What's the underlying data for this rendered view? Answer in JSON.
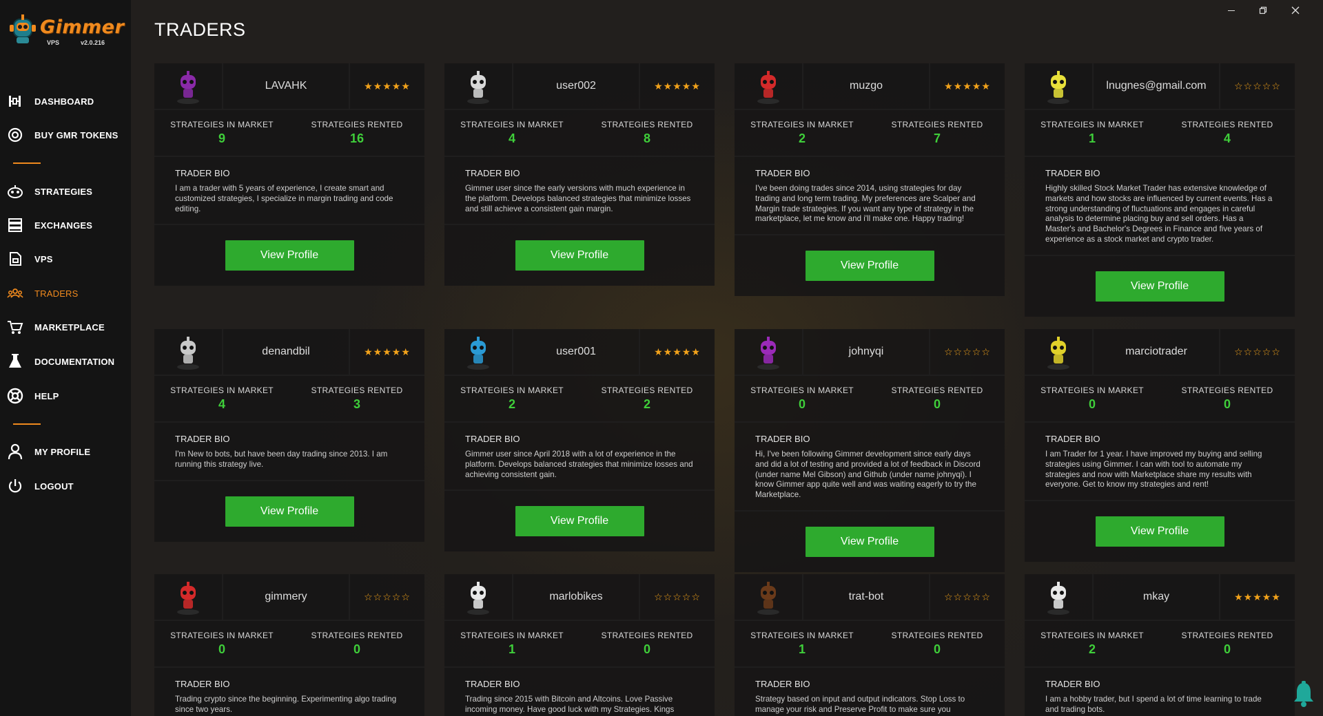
{
  "app": {
    "logo_text": "Gimmer",
    "logo_sub": "VPS",
    "version": "v2.0.216",
    "colors": {
      "accent": "#f08a1e",
      "green": "#2eaa2e",
      "value_green": "#3fcf3a",
      "star": "#f3a31b",
      "bell": "#1fa89a"
    }
  },
  "page": {
    "title": "TRADERS"
  },
  "window_controls": {
    "minimize": "minimize-icon",
    "restore": "restore-icon",
    "close": "close-icon"
  },
  "sidebar": {
    "items": [
      {
        "label": "DASHBOARD",
        "icon": "dashboard-icon"
      },
      {
        "label": "BUY GMR TOKENS",
        "icon": "coin-icon"
      },
      {
        "label": "STRATEGIES",
        "icon": "strategies-icon"
      },
      {
        "label": "EXCHANGES",
        "icon": "exchanges-icon"
      },
      {
        "label": "VPS",
        "icon": "vps-icon"
      },
      {
        "label": "TRADERS",
        "icon": "traders-icon",
        "active": true
      },
      {
        "label": "MARKETPLACE",
        "icon": "cart-icon"
      },
      {
        "label": "DOCUMENTATION",
        "icon": "documentation-icon"
      },
      {
        "label": "HELP",
        "icon": "help-icon"
      },
      {
        "label": "MY PROFILE",
        "icon": "user-icon"
      },
      {
        "label": "LOGOUT",
        "icon": "power-icon"
      }
    ]
  },
  "labels": {
    "in_market": "STRATEGIES IN MARKET",
    "rented": "STRATEGIES RENTED",
    "bio_title": "TRADER BIO",
    "view_profile": "View Profile"
  },
  "traders": [
    {
      "name": "LAVAHK",
      "rating": 5,
      "in_market": "9",
      "rented": "16",
      "avatar_color": "#8a2aa8",
      "bio": "I am a trader with 5 years of experience, I create smart and customized strategies, I specialize in margin trading and code editing."
    },
    {
      "name": "user002",
      "rating": 5,
      "in_market": "4",
      "rented": "8",
      "avatar_color": "#d8d8d8",
      "bio": "Gimmer user since the early versions with much experience in the platform. Develops balanced strategies that minimize losses and still achieve a consistent gain margin."
    },
    {
      "name": "muzgo",
      "rating": 5,
      "in_market": "2",
      "rented": "7",
      "avatar_color": "#d42a2a",
      "bio": "I've been doing trades since 2014, using strategies for day trading and long term trading. My preferences are Scalper and Margin trade strategies. If you want any type of strategy in the marketplace, let me know and i'll make one. Happy trading!"
    },
    {
      "name": "lnugnes@gmail.com",
      "rating": 0,
      "in_market": "1",
      "rented": "4",
      "avatar_color": "#e8e03a",
      "bio": "Highly skilled Stock Market Trader has extensive knowledge of markets and how stocks are influenced by current events. Has a strong understanding of fluctuations and engages in careful analysis to determine placing buy and sell orders. Has a Master's and Bachelor's Degrees in Finance and five years of experience as a stock market and crypto trader."
    },
    {
      "name": "denandbil",
      "rating": 5,
      "in_market": "4",
      "rented": "3",
      "avatar_color": "#c8c8c8",
      "bio": "I'm New to bots, but have been day trading since 2013. I am running this strategy live."
    },
    {
      "name": "user001",
      "rating": 5,
      "in_market": "2",
      "rented": "2",
      "avatar_color": "#2a9ad4",
      "bio": "Gimmer user since April 2018 with a lot of experience in the platform. Develops balanced strategies that minimize losses and achieving consistent gain."
    },
    {
      "name": "johnyqi",
      "rating": 0,
      "in_market": "0",
      "rented": "0",
      "avatar_color": "#9a2ab8",
      "bio": "Hi, I've been following Gimmer development since early days and did a lot of testing and provided a lot of feedback in Discord (under name Mel Gibson) and Github (under name johnyqi). I know Gimmer app quite well and was waiting eagerly to try the Marketplace."
    },
    {
      "name": "marciotrader",
      "rating": 0,
      "in_market": "0",
      "rented": "0",
      "avatar_color": "#e0d02a",
      "bio": "I am Trader for 1 year. I have improved my buying and selling strategies using Gimmer. I can with tool to automate my strategies and now with Marketplace share my results with everyone. Get to know my strategies and rent!"
    },
    {
      "name": "gimmery",
      "rating": 0,
      "in_market": "0",
      "rented": "0",
      "avatar_color": "#d42a2a",
      "bio": "Trading crypto since the beginning. Experimenting algo trading since two years."
    },
    {
      "name": "marlobikes",
      "rating": 0,
      "in_market": "1",
      "rented": "0",
      "avatar_color": "#e8e8e8",
      "bio": "Trading since 2015 with Bitcoin and Altcoins. Love Passive incoming money. Have good luck with my Strategies. Kings"
    },
    {
      "name": "trat-bot",
      "rating": 0,
      "in_market": "1",
      "rented": "0",
      "avatar_color": "#6a3a1a",
      "bio": "Strategy based on input and output indicators. Stop Loss to manage your risk and Preserve Profit to make sure you"
    },
    {
      "name": "mkay",
      "rating": 5,
      "in_market": "2",
      "rented": "0",
      "avatar_color": "#e8e8e8",
      "bio": "I am a hobby trader, but I spend a lot of time learning to trade and trading bots."
    }
  ]
}
